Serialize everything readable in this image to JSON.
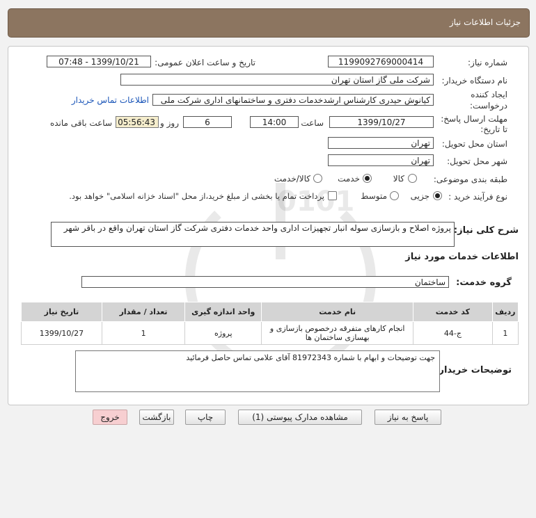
{
  "header": {
    "title": "جزئیات اطلاعات نیاز"
  },
  "form": {
    "need_number_label": "شماره نیاز:",
    "need_number": "1199092769000414",
    "announce_label": "تاریخ و ساعت اعلان عمومی:",
    "announce_value": "1399/10/21 - 07:48",
    "buyer_org_label": "نام دستگاه خریدار:",
    "buyer_org": "شرکت ملی گاز استان تهران",
    "creator_label_1": "ایجاد کننده",
    "creator_label_2": "درخواست:",
    "creator": "کیانوش حیدری کارشناس ارشدخدمات دفتری و ساختمانهای اداری شرکت ملی",
    "contact_link": "اطلاعات تماس خریدار",
    "deadline_label_1": "مهلت ارسال پاسخ:",
    "deadline_label_2": "تا تاریخ:",
    "deadline_date": "1399/10/27",
    "time_label": "ساعت",
    "deadline_time": "14:00",
    "days_value": "6",
    "days_label": "روز و",
    "remaining_time": "05:56:43",
    "remaining_label": "ساعت باقی مانده",
    "province_label": "استان محل تحویل:",
    "province": "تهران",
    "city_label": "شهر محل تحویل:",
    "city": "تهران",
    "category_label": "طبقه بندی موضوعی:",
    "category_options": [
      "کالا",
      "خدمت",
      "کالا/خدمت"
    ],
    "category_selected": "خدمت",
    "process_label": "نوع فرآیند خرید :",
    "process_options": [
      "جزیی",
      "متوسط"
    ],
    "process_selected": "جزیی",
    "payment_note": "پرداخت تمام یا بخشی از مبلغ خرید،از محل \"اسناد خزانه اسلامی\" خواهد بود."
  },
  "need_description": {
    "label": "شرح کلی نیاز:",
    "text": "پروژه اصلاح و بازسازی سوله انبار تجهیزات اداری واحد خدمات دفتری شرکت گاز استان تهران واقع در باقر شهر"
  },
  "services": {
    "section_title": "اطلاعات خدمات مورد نیاز",
    "group_label": "گروه خدمت:",
    "group_value": "ساختمان",
    "columns": [
      "ردیف",
      "کد خدمت",
      "نام خدمت",
      "واحد اندازه گیری",
      "تعداد / مقدار",
      "تاریخ نیاز"
    ],
    "rows": [
      {
        "row": "1",
        "code": "ج-44",
        "name": "انجام کارهای متفرقه درخصوص بازسازی و بهسازی ساختمان ها",
        "unit": "پروژه",
        "qty": "1",
        "date": "1399/10/27"
      }
    ]
  },
  "buyer_notes": {
    "label": "توضیحات خریدار:",
    "text": "جهت توضیحات و ابهام با شماره 81972343 آقای علامی تماس حاصل فرمائید"
  },
  "buttons": {
    "reply": "پاسخ به نیاز",
    "attachments": "مشاهده مدارک پیوستی (1)",
    "print": "چاپ",
    "back": "بازگشت",
    "exit": "خروج"
  },
  "watermark": {
    "brand": "ParsNamadData",
    "digits": "0101"
  }
}
